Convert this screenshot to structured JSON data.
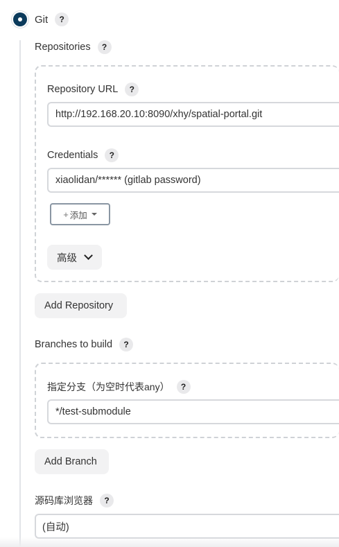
{
  "scm": {
    "option_label": "Git",
    "help_glyph": "?"
  },
  "repositories": {
    "label": "Repositories",
    "url_label": "Repository URL",
    "url_value": "http://192.168.20.10:8090/xhy/spatial-portal.git",
    "credentials_label": "Credentials",
    "credentials_value": "xiaolidan/****** (gitlab password)",
    "add_credential_plus": "+",
    "add_credential_label": "添加",
    "advanced_label": "高级",
    "add_repository_label": "Add Repository"
  },
  "branches": {
    "label": "Branches to build",
    "specifier_label": "指定分支（为空时代表any）",
    "specifier_value": "*/test-submodule",
    "add_branch_label": "Add Branch"
  },
  "browser": {
    "label": "源码库浏览器",
    "value": "(自动)"
  },
  "colors": {
    "radio_selected": "#0b3b5c",
    "help_bg": "#e9e9eb",
    "dashed_border": "#cfd2d6"
  }
}
